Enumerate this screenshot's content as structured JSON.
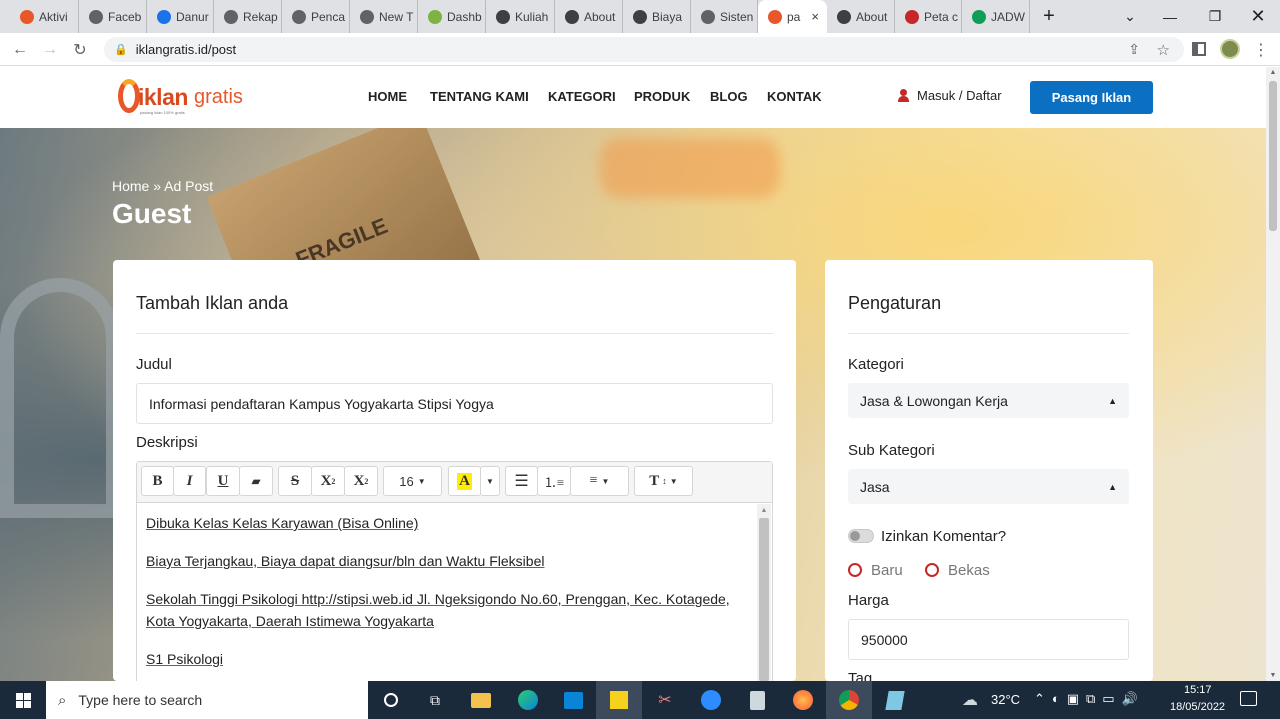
{
  "browser": {
    "tabs": [
      {
        "label": "Aktivi",
        "color": "#e8572a"
      },
      {
        "label": "Faceb",
        "color": "#5f6368"
      },
      {
        "label": "Danur",
        "color": "#1a73e8"
      },
      {
        "label": "Rekap",
        "color": "#5f6368"
      },
      {
        "label": "Penca",
        "color": "#5f6368"
      },
      {
        "label": "New T",
        "color": "#5f6368"
      },
      {
        "label": "Dashb",
        "color": "#7cb342"
      },
      {
        "label": "Kuliah",
        "color": "#3c4043"
      },
      {
        "label": "About",
        "color": "#3c4043"
      },
      {
        "label": "Biaya",
        "color": "#3c4043"
      },
      {
        "label": "Sisten",
        "color": "#5f6368"
      },
      {
        "label": "pa",
        "color": "#e8572a"
      },
      {
        "label": "About",
        "color": "#3c4043"
      },
      {
        "label": "Peta c",
        "color": "#c62828"
      },
      {
        "label": "JADW",
        "color": "#0f9d58"
      }
    ],
    "url": "iklangratis.id/post",
    "new_tab": "+",
    "close_tab": "×"
  },
  "site": {
    "logo_main": "iklan",
    "logo_accent": "gratis",
    "logo_tagline": "pasang iklan 100% gratis",
    "nav": [
      "HOME",
      "TENTANG KAMI",
      "KATEGORI",
      "PRODUK",
      "BLOG",
      "KONTAK"
    ],
    "login": "Masuk / Daftar",
    "cta": "Pasang Iklan",
    "brand_color": "#0b6fc2"
  },
  "hero": {
    "crumb_home": "Home",
    "crumb_sep": "»",
    "crumb_current": "Ad Post",
    "title": "Guest",
    "box_text": "FRAGILE"
  },
  "form": {
    "heading": "Tambah Iklan anda",
    "title_label": "Judul",
    "title_value": "Informasi pendaftaran Kampus Yogyakarta Stipsi Yogya",
    "desc_label": "Deskripsi",
    "toolbar": {
      "bold": "B",
      "italic": "I",
      "underline": "U",
      "strike": "S",
      "sup": "X",
      "sub": "X",
      "font_size": "16",
      "highlight": "A",
      "text_style": "T"
    },
    "desc_paragraphs": [
      "Dibuka Kelas Kelas Karyawan (Bisa Online)",
      "Biaya Terjangkau, Biaya dapat diangsur/bln dan Waktu Fleksibel",
      "Sekolah Tinggi Psikologi http://stipsi.web.id    Jl. Ngeksigondo No.60, Prenggan, Kec. Kotagede, Kota Yogyakarta, Daerah Istimewa Yogyakarta",
      "S1 Psikologi"
    ]
  },
  "settings": {
    "heading": "Pengaturan",
    "category_label": "Kategori",
    "category_value": "Jasa & Lowongan Kerja",
    "subcategory_label": "Sub Kategori",
    "subcategory_value": "Jasa",
    "comments_label": "Izinkan Komentar?",
    "condition_new": "Baru",
    "condition_used": "Bekas",
    "price_label": "Harga",
    "price_value": "950000",
    "tag_label": "Tag"
  },
  "taskbar": {
    "search_placeholder": "Type here to search",
    "temperature": "32°C",
    "time": "15:17",
    "date": "18/05/2022"
  }
}
